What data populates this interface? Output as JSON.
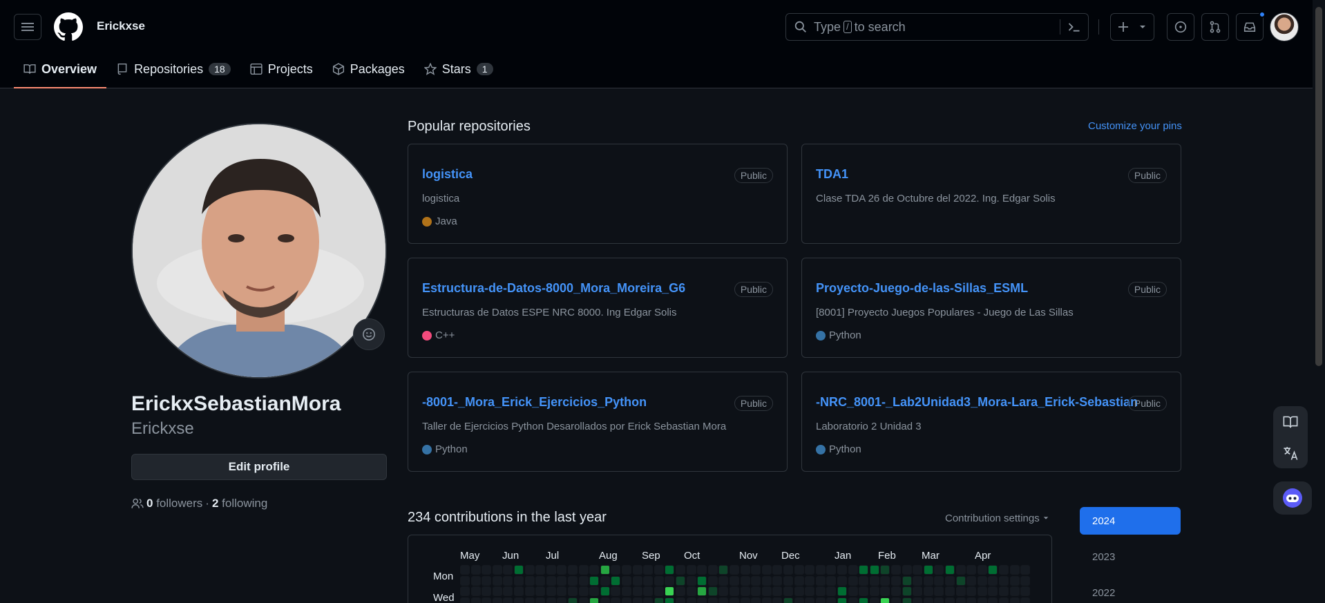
{
  "header": {
    "username": "Erickxse",
    "search_prefix": "Type",
    "search_key": "/",
    "search_suffix": "to search"
  },
  "tabs": [
    {
      "label": "Overview",
      "count": ""
    },
    {
      "label": "Repositories",
      "count": "18"
    },
    {
      "label": "Projects",
      "count": ""
    },
    {
      "label": "Packages",
      "count": ""
    },
    {
      "label": "Stars",
      "count": "1"
    }
  ],
  "profile": {
    "full_name": "ErickxSebastianMora",
    "login": "Erickxse",
    "edit_label": "Edit profile",
    "followers_count": "0",
    "followers_label": "followers",
    "separator": "·",
    "following_count": "2",
    "following_label": "following"
  },
  "popular": {
    "title": "Popular repositories",
    "customize_label": "Customize your pins",
    "repos": [
      {
        "name": "logistica",
        "visibility": "Public",
        "description": "logistica",
        "language": "Java",
        "lang_color": "#b07219"
      },
      {
        "name": "TDA1",
        "visibility": "Public",
        "description": "Clase TDA 26 de Octubre del 2022. Ing. Edgar Solis",
        "language": "",
        "lang_color": ""
      },
      {
        "name": "Estructura-de-Datos-8000_Mora_Moreira_G6",
        "visibility": "Public",
        "description": "Estructuras de Datos ESPE NRC 8000. Ing Edgar Solis",
        "language": "C++",
        "lang_color": "#f34b7d"
      },
      {
        "name": "Proyecto-Juego-de-las-Sillas_ESML",
        "visibility": "Public",
        "description": "[8001] Proyecto Juegos Populares - Juego de Las Sillas",
        "language": "Python",
        "lang_color": "#3572a5"
      },
      {
        "name": "-8001-_Mora_Erick_Ejercicios_Python",
        "visibility": "Public",
        "description": "Taller de Ejercicios Python Desarollados por Erick Sebastian Mora",
        "language": "Python",
        "lang_color": "#3572a5"
      },
      {
        "name": "-NRC_8001-_Lab2Unidad3_Mora-Lara_Erick-Sebastian",
        "visibility": "Public",
        "description": "Laboratorio 2 Unidad 3",
        "language": "Python",
        "lang_color": "#3572a5"
      }
    ]
  },
  "contributions": {
    "title": "234 contributions in the last year",
    "settings_label": "Contribution settings",
    "months": [
      "May",
      "Jun",
      "Jul",
      "Aug",
      "Sep",
      "Oct",
      "Nov",
      "Dec",
      "Jan",
      "Feb",
      "Mar",
      "Apr"
    ],
    "day_labels": [
      "Mon",
      "Wed"
    ],
    "years": [
      "2024",
      "2023",
      "2022"
    ],
    "active_year": "2024",
    "colors": {
      "level0": "#161b22",
      "level1": "#0e4429",
      "level2": "#006d32",
      "level3": "#26a641",
      "level4": "#39d353"
    }
  }
}
